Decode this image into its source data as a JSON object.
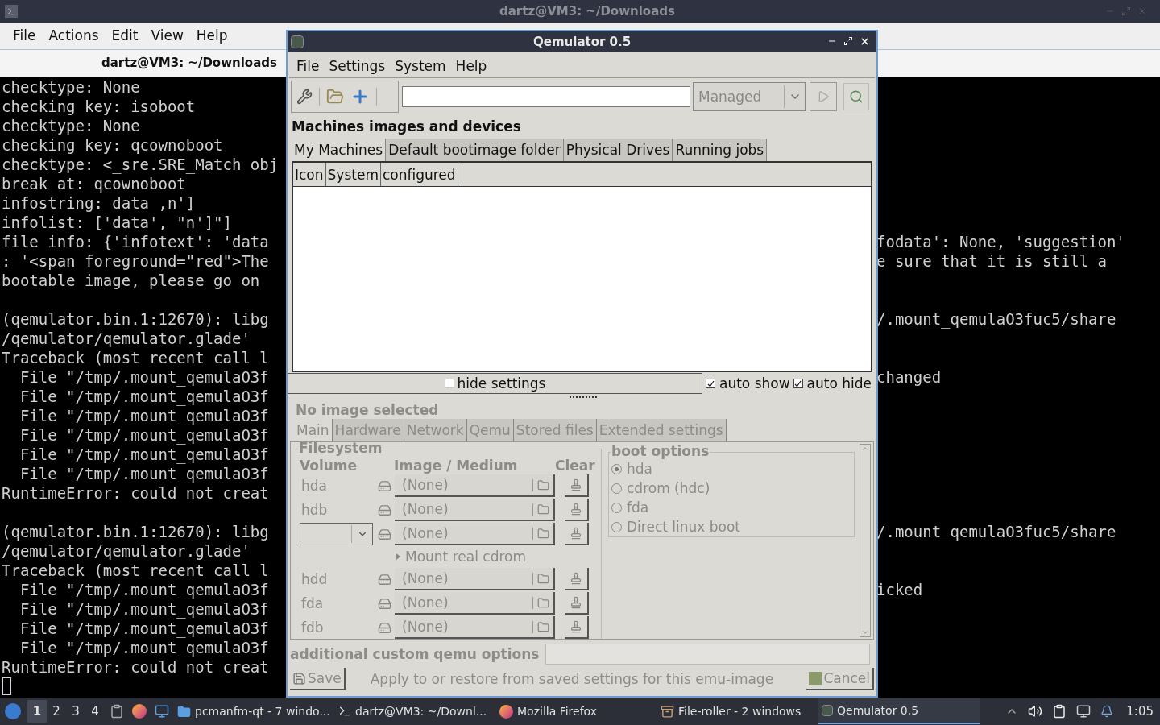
{
  "terminal": {
    "title": "dartz@VM3: ~/Downloads",
    "menu": [
      "File",
      "Actions",
      "Edit",
      "View",
      "Help"
    ],
    "tab": "dartz@VM3: ~/Downloads",
    "lines": [
      {
        "kind": "text",
        "left": "checktype: None"
      },
      {
        "kind": "text",
        "left": "checking key: isoboot"
      },
      {
        "kind": "text",
        "left": "checktype: None"
      },
      {
        "kind": "text",
        "left": "checking key: qcownoboot"
      },
      {
        "kind": "text",
        "left": "checktype: <_sre.SRE_Match obj"
      },
      {
        "kind": "text",
        "left": "break at: qcownoboot"
      },
      {
        "kind": "text",
        "left": "infostring: data ,n']"
      },
      {
        "kind": "text",
        "left": "infolist: ['data', \"n']\"]"
      },
      {
        "kind": "text",
        "left": "file info: {'infotext': 'data",
        "right": "fodata': None, 'suggestion'"
      },
      {
        "kind": "text",
        "left": ": '<span foreground=\"red\">The",
        "right": "e sure that it is still a"
      },
      {
        "kind": "text",
        "left": "bootable image, please go on"
      },
      {
        "kind": "blank"
      },
      {
        "kind": "text",
        "left": "(qemulator.bin.1:12670): libg",
        "right": "/.mount_qemulaO3fuc5/share"
      },
      {
        "kind": "text",
        "left": "/qemulator/qemulator.glade'"
      },
      {
        "kind": "text",
        "left": "Traceback (most recent call l"
      },
      {
        "kind": "text",
        "left": "  File \"/tmp/.mount_qemulaO3f",
        "right": "changed"
      },
      {
        "kind": "text",
        "left": "  File \"/tmp/.mount_qemulaO3f"
      },
      {
        "kind": "text",
        "left": "  File \"/tmp/.mount_qemulaO3f"
      },
      {
        "kind": "text",
        "left": "  File \"/tmp/.mount_qemulaO3f"
      },
      {
        "kind": "text",
        "left": "  File \"/tmp/.mount_qemulaO3f"
      },
      {
        "kind": "text",
        "left": "  File \"/tmp/.mount_qemulaO3f"
      },
      {
        "kind": "text",
        "left": "RuntimeError: could not creat"
      },
      {
        "kind": "blank"
      },
      {
        "kind": "text",
        "left": "(qemulator.bin.1:12670): libg",
        "right": "/.mount_qemulaO3fuc5/share"
      },
      {
        "kind": "text",
        "left": "/qemulator/qemulator.glade'"
      },
      {
        "kind": "text",
        "left": "Traceback (most recent call l"
      },
      {
        "kind": "text",
        "left": "  File \"/tmp/.mount_qemulaO3f",
        "right": "icked"
      },
      {
        "kind": "text",
        "left": "  File \"/tmp/.mount_qemulaO3f"
      },
      {
        "kind": "text",
        "left": "  File \"/tmp/.mount_qemulaO3f"
      },
      {
        "kind": "text",
        "left": "  File \"/tmp/.mount_qemulaO3f"
      },
      {
        "kind": "text",
        "left": "RuntimeError: could not creat"
      },
      {
        "kind": "cursor"
      }
    ]
  },
  "dialog": {
    "title": "Qemulator 0.5",
    "menu": [
      "File",
      "Settings",
      "System",
      "Help"
    ],
    "mode": "Managed",
    "heading": "Machines images and devices",
    "tabs": [
      {
        "label": "My Machines",
        "selected": true
      },
      {
        "label": "Default bootimage folder",
        "selected": false
      },
      {
        "label": "Physical Drives",
        "selected": false
      },
      {
        "label": "Running jobs",
        "selected": false
      }
    ],
    "table": {
      "columns": [
        "Icon",
        "System",
        "configured"
      ]
    },
    "hide_settings": "hide settings",
    "checkboxes": [
      {
        "label": "auto show",
        "checked": true
      },
      {
        "label": "auto hide",
        "checked": true
      }
    ],
    "settings": {
      "title": "No image selected",
      "disabled": true,
      "tabs": [
        {
          "label": "Main",
          "selected": true
        },
        {
          "label": "Hardware",
          "selected": false
        },
        {
          "label": "Network",
          "selected": false
        },
        {
          "label": "Qemu",
          "selected": false
        },
        {
          "label": "Stored files",
          "selected": false
        },
        {
          "label": "Extended settings",
          "selected": false
        }
      ],
      "filesystem": {
        "title": "Filesystem",
        "columns": [
          "Volume",
          "Image / Medium",
          "Clear"
        ],
        "rows": [
          {
            "kind": "drive",
            "volume": "hda",
            "value": "(None)"
          },
          {
            "kind": "drive",
            "volume": "hdb",
            "value": "(None)"
          },
          {
            "kind": "dropdown",
            "value": "(None)"
          },
          {
            "kind": "expander",
            "label": "Mount real cdrom"
          },
          {
            "kind": "drive",
            "volume": "hdd",
            "value": "(None)"
          },
          {
            "kind": "drive",
            "volume": "fda",
            "value": "(None)"
          },
          {
            "kind": "drive",
            "volume": "fdb",
            "value": "(None)"
          }
        ]
      },
      "boot_options": {
        "title": "boot options",
        "options": [
          {
            "label": "hda",
            "selected": true
          },
          {
            "label": "cdrom (hdc)",
            "selected": false
          },
          {
            "label": "fda",
            "selected": false
          },
          {
            "label": "Direct linux boot",
            "selected": false
          }
        ]
      },
      "custom_options_label": "additional custom qemu options",
      "buttons": [
        {
          "label": "Save",
          "disabled": true
        },
        {
          "label": "Cancel",
          "disabled": true
        }
      ],
      "hint": "Apply to or restore from saved settings for this emu-image"
    }
  },
  "taskbar": {
    "desktops": [
      {
        "label": "1",
        "selected": true
      },
      {
        "label": "2",
        "selected": false
      },
      {
        "label": "3",
        "selected": false
      },
      {
        "label": "4",
        "selected": false
      }
    ],
    "tasks": [
      {
        "kind": "files",
        "label": "pcmanfm-qt - 7 windo...",
        "selected": false
      },
      {
        "kind": "terminal",
        "label": "dartz@VM3: ~/Downl...",
        "selected": false
      },
      {
        "kind": "browser",
        "label": "Mozilla Firefox",
        "selected": false
      },
      {
        "kind": "archive",
        "label": "File-roller - 2 windows",
        "selected": false
      },
      {
        "kind": "emulator",
        "label": "Qemulator 0.5",
        "selected": true
      }
    ],
    "clock": "1:05"
  }
}
